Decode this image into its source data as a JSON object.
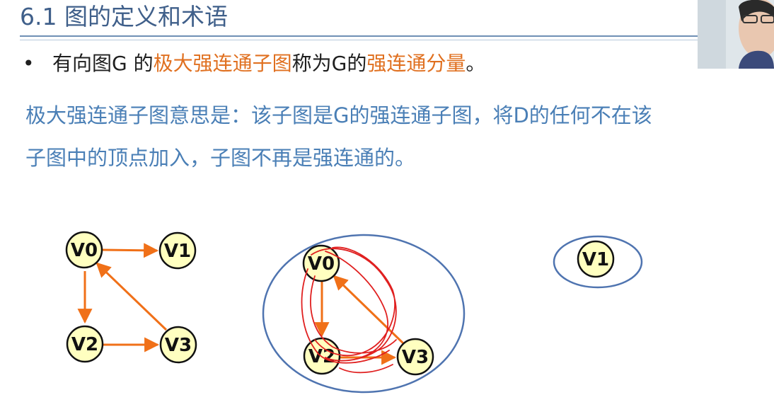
{
  "title": "6.1 图的定义和术语",
  "bullet": {
    "marker": "•",
    "seg1": "有向图G 的",
    "seg2": "极大强连通子图",
    "seg3": "称为G的",
    "seg4": "强连通分量",
    "seg5": "。"
  },
  "explanation": {
    "line1": "极大强连通子图意思是：该子图是G的强连通子图，将D的任何不在该",
    "line2": "子图中的顶点加入，子图不再是强连通的。"
  },
  "graph_left": {
    "nodes": [
      "V0",
      "V1",
      "V2",
      "V3"
    ]
  },
  "graph_component": {
    "nodes": [
      "V0",
      "V2",
      "V3"
    ]
  },
  "graph_single": {
    "nodes": [
      "V1"
    ]
  },
  "colors": {
    "title": "#3f5f8a",
    "highlight": "#e07020",
    "explanation": "#4a7fb6",
    "node_fill": "#ffffc0",
    "edge": "#f07018",
    "ellipse": "#4f74b0",
    "scribble": "#e02020"
  }
}
